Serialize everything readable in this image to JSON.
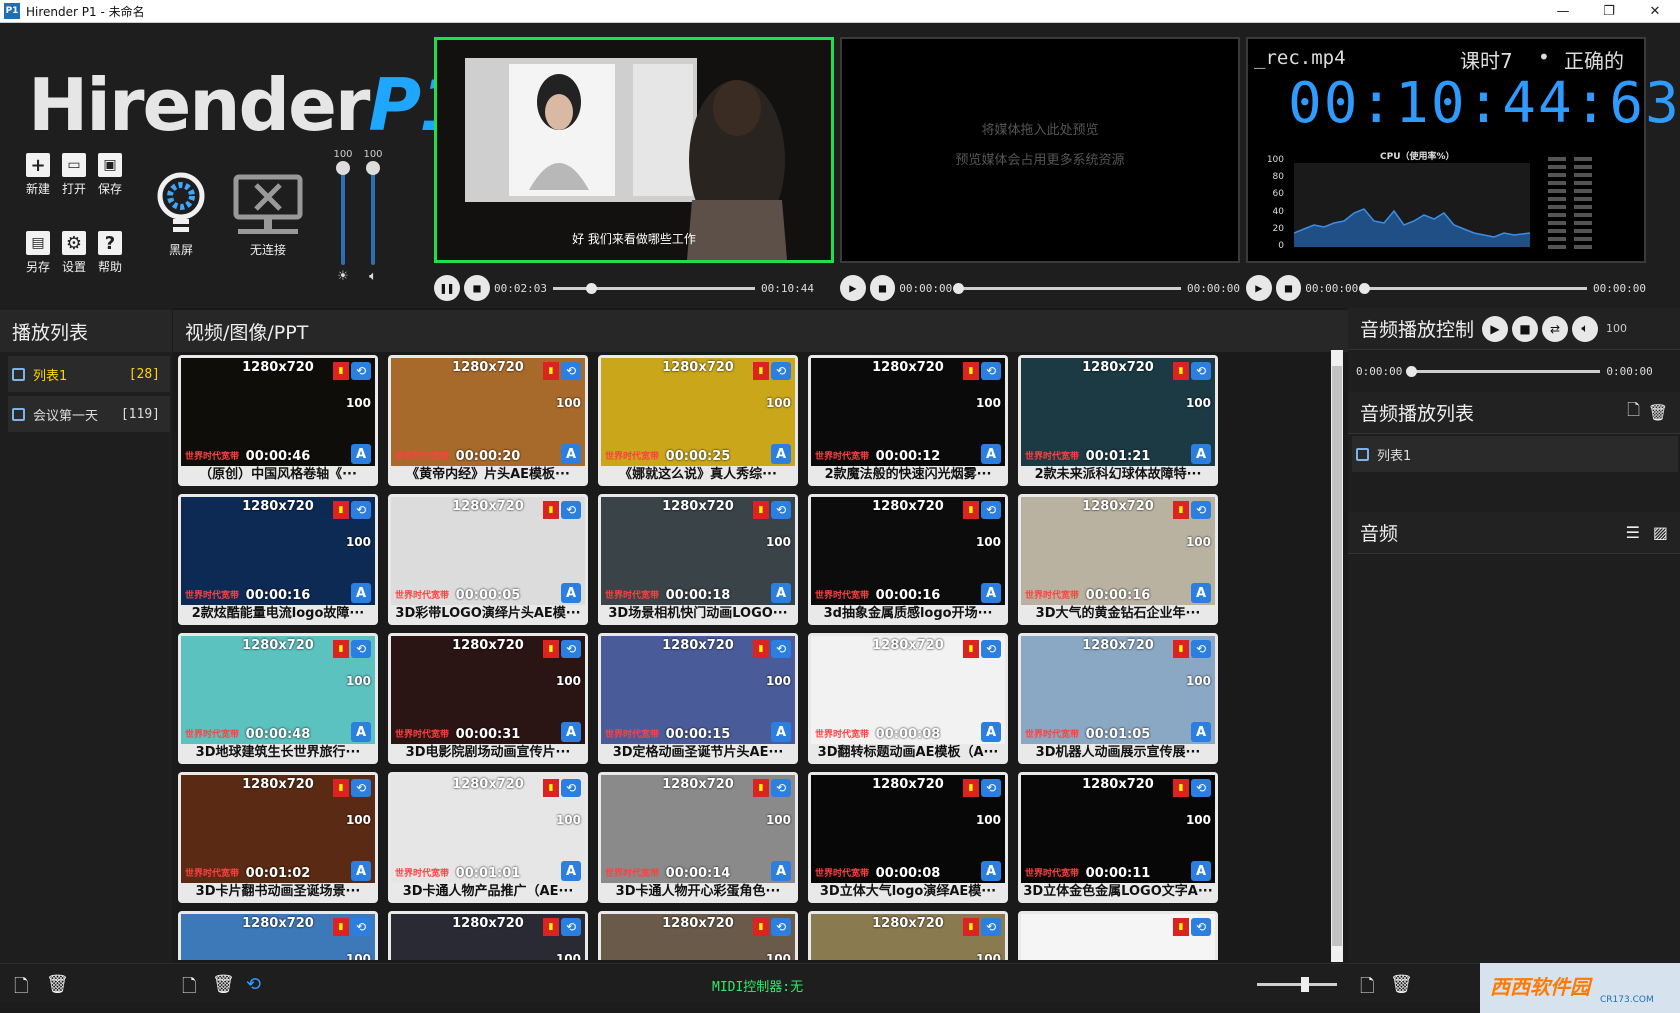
{
  "window": {
    "title": "Hirender P1 - 未命名",
    "app_icon": "P1",
    "controls": [
      "—",
      "❐",
      "✕"
    ]
  },
  "logo": {
    "text": "Hirender",
    "accent": "P1"
  },
  "toolbar": {
    "new_label": "新建",
    "open_label": "打开",
    "save_label": "保存",
    "saveas_label": "另存",
    "settings_label": "设置",
    "help_label": "帮助",
    "blackscreen_label": "黑屏",
    "connection_label": "无连接"
  },
  "sliders": {
    "brightness_value": "100",
    "volume_value": "100"
  },
  "preview": {
    "subtitle": "好 我们来看做哪些工作",
    "time_current": "00:02:03",
    "time_total": "00:10:44",
    "progress": 0.19
  },
  "preview2": {
    "hint_line1": "将媒体拖入此处预览",
    "hint_line2": "预览媒体会占用更多系统资源",
    "time_current": "00:00:00",
    "time_total": "00:00:00",
    "progress": 0
  },
  "monitor": {
    "filename": "_rec.mp4",
    "lesson": "课时7",
    "bullet": "•",
    "status": "正确的",
    "clock": "00:10:44:63",
    "cpu_label": "CPU（使用率%）",
    "cpu_ticks": [
      "100",
      "80",
      "60",
      "40",
      "20",
      "0"
    ],
    "time_current": "00:00:00",
    "time_total": "00:00:00",
    "progress": 0
  },
  "playlist": {
    "header": "播放列表",
    "items": [
      {
        "label": "列表1",
        "count": "[28]",
        "active": true
      },
      {
        "label": "会议第一天",
        "count": "[119]",
        "active": false
      }
    ]
  },
  "media": {
    "header": "视频/图像/PPT",
    "cards": [
      {
        "res": "1280x720",
        "vol": "100",
        "dur": "00:00:46",
        "name": "（原创）中国风格卷轴《···",
        "bg": "#0e0d0a"
      },
      {
        "res": "1280x720",
        "vol": "100",
        "dur": "00:00:20",
        "name": "《黄帝内经》片头AE模板···",
        "bg": "#a86a2a"
      },
      {
        "res": "1280x720",
        "vol": "100",
        "dur": "00:00:25",
        "name": "《娜就这么说》真人秀综···",
        "bg": "#c9a61a"
      },
      {
        "res": "1280x720",
        "vol": "100",
        "dur": "00:00:12",
        "name": "2款魔法般的快速闪光烟雾···",
        "bg": "#0a0a0a"
      },
      {
        "res": "1280x720",
        "vol": "100",
        "dur": "00:01:21",
        "name": "2款未来派科幻球体故障特···",
        "bg": "#1c3a44"
      },
      {
        "res": "1280x720",
        "vol": "100",
        "dur": "00:00:16",
        "name": "2款炫酷能量电流logo故障···",
        "bg": "#0d2a55"
      },
      {
        "res": "1280x720",
        "vol": "",
        "dur": "00:00:05",
        "name": "3D彩带LOGO演绎片头AE模···",
        "bg": "#dcdcdc"
      },
      {
        "res": "1280x720",
        "vol": "100",
        "dur": "00:00:18",
        "name": "3D场景相机快门动画LOGO···",
        "bg": "#3a4348"
      },
      {
        "res": "1280x720",
        "vol": "100",
        "dur": "00:00:16",
        "name": "3d抽象金属质感logo开场···",
        "bg": "#0c0c0c"
      },
      {
        "res": "1280x720",
        "vol": "100",
        "dur": "00:00:16",
        "name": "3D大气的黄金钻石企业年···",
        "bg": "#b9b2a0"
      },
      {
        "res": "1280x720",
        "vol": "100",
        "dur": "00:00:48",
        "name": "3D地球建筑生长世界旅行···",
        "bg": "#5bc2c0"
      },
      {
        "res": "1280x720",
        "vol": "100",
        "dur": "00:00:31",
        "name": "3D电影院剧场动画宣传片···",
        "bg": "#2a1414"
      },
      {
        "res": "1280x720",
        "vol": "100",
        "dur": "00:00:15",
        "name": "3D定格动画圣诞节片头AE···",
        "bg": "#4a5b9a"
      },
      {
        "res": "1280x720",
        "vol": "",
        "dur": "00:00:08",
        "name": "3D翻转标题动画AE模板（A···",
        "bg": "#f2f2f2"
      },
      {
        "res": "1280x720",
        "vol": "100",
        "dur": "00:01:05",
        "name": "3D机器人动画展示宣传展···",
        "bg": "#8aa8c4"
      },
      {
        "res": "1280x720",
        "vol": "100",
        "dur": "00:01:02",
        "name": "3D卡片翻书动画圣诞场景···",
        "bg": "#5a2a14"
      },
      {
        "res": "1280x720",
        "vol": "100",
        "dur": "00:01:01",
        "name": "3D卡通人物产品推广（AE···",
        "bg": "#e6e6e6"
      },
      {
        "res": "1280x720",
        "vol": "100",
        "dur": "00:00:14",
        "name": "3D卡通人物开心彩蛋角色···",
        "bg": "#8a8a8a"
      },
      {
        "res": "1280x720",
        "vol": "100",
        "dur": "00:00:08",
        "name": "3D立体大气logo演绎AE模···",
        "bg": "#070707"
      },
      {
        "res": "1280x720",
        "vol": "100",
        "dur": "00:00:11",
        "name": "3D立体金色金属LOGO文字A···",
        "bg": "#070707"
      },
      {
        "res": "1280x720",
        "vol": "100",
        "dur": "",
        "name": "",
        "bg": "#3d79b8"
      },
      {
        "res": "1280x720",
        "vol": "100",
        "dur": "",
        "name": "",
        "bg": "#2a2a35"
      },
      {
        "res": "1280x720",
        "vol": "100",
        "dur": "",
        "name": "",
        "bg": "#6a5a4a"
      },
      {
        "res": "1280x720",
        "vol": "100",
        "dur": "",
        "name": "",
        "bg": "#8a7a50"
      },
      {
        "res": "",
        "vol": "",
        "dur": "",
        "name": "",
        "bg": "#f5f5f5"
      }
    ],
    "watermark": "世界时代宽带"
  },
  "audio": {
    "control_header": "音频播放控制",
    "volume": "100",
    "time_current": "0:00:00",
    "time_total": "0:00:00",
    "list_header": "音频播放列表",
    "list_items": [
      {
        "label": "列表1"
      }
    ],
    "audio_header": "音频"
  },
  "statusbar": {
    "midi": "MIDI控制器:无",
    "zoom": 0.6
  },
  "corner_logo": {
    "text": "西西软件园",
    "sub": "CR173.COM"
  }
}
